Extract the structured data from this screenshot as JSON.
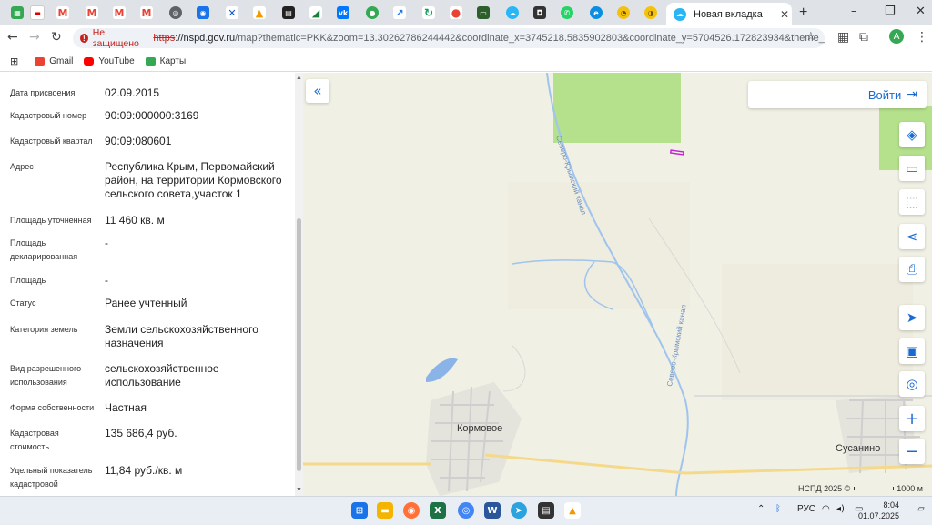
{
  "browser": {
    "active_tab_title": "Новая вкладка",
    "insecure_label": "Не защищено",
    "url_scheme": "https",
    "url_host": "://nspd.gov.ru",
    "url_rest": "/map?thematic=PKK&zoom=13.30262786244442&coordinate_x=3745218.5835902803&coordinate_y=5704526.172823934&theme_id=1&is_copy_url=t...",
    "profile_initial": "A"
  },
  "bookmarks": [
    {
      "label": "Gmail"
    },
    {
      "label": "YouTube"
    },
    {
      "label": "Карты"
    }
  ],
  "info": [
    {
      "label": "Дата присвоения",
      "value": "02.09.2015"
    },
    {
      "label": "Кадастровый номер",
      "value": "90:09:000000:3169"
    },
    {
      "label": "Кадастровый квартал",
      "value": "90:09:080601"
    },
    {
      "label": "Адрес",
      "value": "Республика Крым, Первомайский район, на территории Кормовского сельского совета,участок 1"
    },
    {
      "label": "Площадь уточненная",
      "value": "11 460 кв. м"
    },
    {
      "label": "Площадь декларированная",
      "value": "-"
    },
    {
      "label": "Площадь",
      "value": "-"
    },
    {
      "label": "Статус",
      "value": "Ранее учтенный"
    },
    {
      "label": "Категория земель",
      "value": "Земли сельскохозяйственного назначения"
    },
    {
      "label": "Вид разрешенного использования",
      "value": "сельскохозяйственное использование"
    },
    {
      "label": "Форма собственности",
      "value": "Частная"
    },
    {
      "label": "Кадастровая стоимость",
      "value": "135 686,4 руб."
    },
    {
      "label": "Удельный показатель кадастровой",
      "value": "11,84 руб./кв. м"
    }
  ],
  "map": {
    "login_label": "Войти",
    "places": {
      "kormovoe": "Кормовое",
      "susanino": "Сусанино"
    },
    "canal_label": "Северо-Крымский канал",
    "copyright": "НСПД 2025 ©",
    "scale_label": "1000 м"
  },
  "taskbar": {
    "lang": "РУС",
    "time": "8:04",
    "date": "01.07.2025"
  },
  "colors": {
    "accent": "#1a6bd1",
    "insecure": "#c5221f",
    "field_green": "#b5e08c",
    "map_bg": "#f1f0e4",
    "parcel": "#c026d3"
  }
}
